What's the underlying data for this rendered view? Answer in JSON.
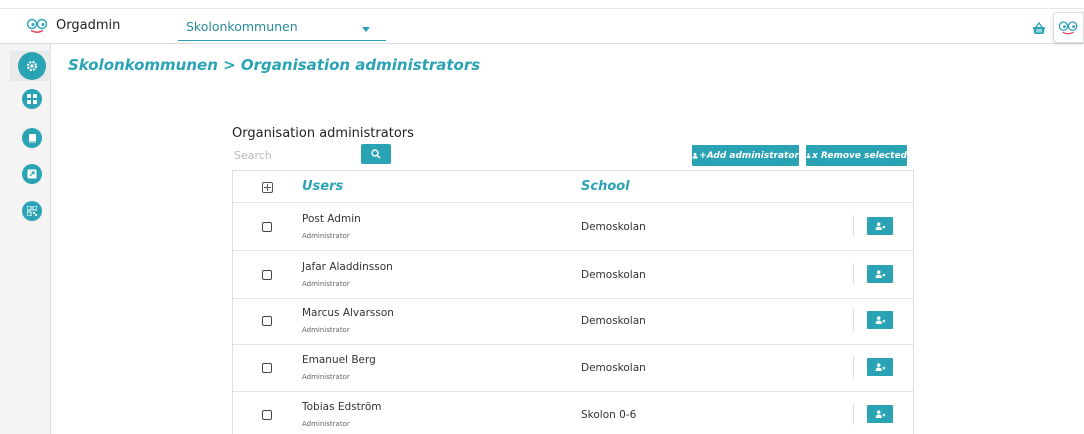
{
  "header": {
    "app_name": "Orgadmin",
    "org_select_value": "Skolonkommunen"
  },
  "breadcrumb": "Skolonkommunen > Organisation administrators",
  "panel": {
    "title": "Organisation administrators",
    "search_placeholder": "Search",
    "add_button": "+Add administrator",
    "remove_button": "x Remove selected"
  },
  "table": {
    "col_users": "Users",
    "col_school": "School",
    "rows": [
      {
        "name": "Post Admin",
        "role": "Administrator",
        "school": "Demoskolan"
      },
      {
        "name": "Jafar Aladdinsson",
        "role": "Administrator",
        "school": "Demoskolan"
      },
      {
        "name": "Marcus Alvarsson",
        "role": "Administrator",
        "school": "Demoskolan"
      },
      {
        "name": "Emanuel Berg",
        "role": "Administrator",
        "school": "Demoskolan"
      },
      {
        "name": "Tobias Edström",
        "role": "Administrator",
        "school": "Skolon 0-6"
      }
    ]
  },
  "sidebar": {
    "items": [
      {
        "icon": "gear-icon",
        "active": true
      },
      {
        "icon": "apps-grid-icon",
        "active": false
      },
      {
        "icon": "book-icon",
        "active": false
      },
      {
        "icon": "external-link-icon",
        "active": false
      },
      {
        "icon": "qr-code-icon",
        "active": false
      }
    ]
  },
  "colors": {
    "accent": "#2aa3b5",
    "sidebar_bg": "#f4f4f4"
  }
}
